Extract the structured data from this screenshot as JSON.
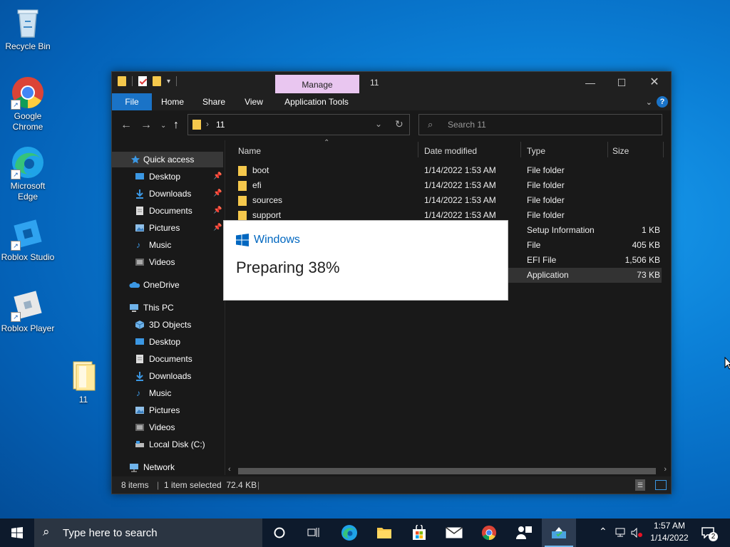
{
  "desktop": {
    "icons": [
      {
        "label": "Recycle Bin"
      },
      {
        "label": "Google Chrome"
      },
      {
        "label": "Microsoft Edge"
      },
      {
        "label": "Roblox Studio"
      },
      {
        "label": "Roblox Player"
      },
      {
        "label": "11"
      }
    ]
  },
  "window": {
    "title": "11",
    "manage_tab": "Manage",
    "ribbon_tabs": [
      "File",
      "Home",
      "Share",
      "View",
      "Application Tools"
    ],
    "address": {
      "path": "11"
    },
    "search": {
      "placeholder": "Search 11"
    },
    "nav": [
      {
        "label": "Quick access",
        "icon": "star-icon",
        "pinned": false
      },
      {
        "label": "Desktop",
        "icon": "desktop-icon",
        "pinned": true
      },
      {
        "label": "Downloads",
        "icon": "download-icon",
        "pinned": true
      },
      {
        "label": "Documents",
        "icon": "documents-icon",
        "pinned": true
      },
      {
        "label": "Pictures",
        "icon": "pictures-icon",
        "pinned": true
      },
      {
        "label": "Music",
        "icon": "music-icon",
        "pinned": false
      },
      {
        "label": "Videos",
        "icon": "videos-icon",
        "pinned": false
      },
      {
        "label": "OneDrive",
        "icon": "cloud-icon",
        "pinned": false
      },
      {
        "label": "This PC",
        "icon": "computer-icon",
        "pinned": false
      },
      {
        "label": "3D Objects",
        "icon": "cube-icon",
        "pinned": false
      },
      {
        "label": "Desktop",
        "icon": "desktop-icon",
        "pinned": false
      },
      {
        "label": "Documents",
        "icon": "documents-icon",
        "pinned": false
      },
      {
        "label": "Downloads",
        "icon": "download-icon",
        "pinned": false
      },
      {
        "label": "Music",
        "icon": "music-icon",
        "pinned": false
      },
      {
        "label": "Pictures",
        "icon": "pictures-icon",
        "pinned": false
      },
      {
        "label": "Videos",
        "icon": "videos-icon",
        "pinned": false
      },
      {
        "label": "Local Disk (C:)",
        "icon": "drive-icon",
        "pinned": false
      },
      {
        "label": "Network",
        "icon": "network-icon",
        "pinned": false
      }
    ],
    "columns": [
      "Name",
      "Date modified",
      "Type",
      "Size"
    ],
    "files": [
      {
        "name": "boot",
        "date": "1/14/2022 1:53 AM",
        "type": "File folder",
        "size": ""
      },
      {
        "name": "efi",
        "date": "1/14/2022 1:53 AM",
        "type": "File folder",
        "size": ""
      },
      {
        "name": "sources",
        "date": "1/14/2022 1:53 AM",
        "type": "File folder",
        "size": ""
      },
      {
        "name": "support",
        "date": "1/14/2022 1:53 AM",
        "type": "File folder",
        "size": ""
      },
      {
        "name": "",
        "date": "",
        "type": "Setup Information",
        "size": "1 KB"
      },
      {
        "name": "",
        "date": "",
        "type": "File",
        "size": "405 KB"
      },
      {
        "name": "",
        "date": "",
        "type": "EFI File",
        "size": "1,506 KB"
      },
      {
        "name": "",
        "date": "",
        "type": "Application",
        "size": "73 KB"
      }
    ],
    "status": {
      "items": "8 items",
      "selected": "1 item selected  72.4 KB"
    }
  },
  "popup": {
    "brand": "Windows",
    "status_text": "Preparing 38%",
    "progress_percent": 38
  },
  "taskbar": {
    "search_placeholder": "Type here to search",
    "time": "1:57 AM",
    "date": "1/14/2022",
    "notification_count": "2"
  },
  "colors": {
    "accent": "#1a73c7",
    "folder": "#f5c84c",
    "manage_tab": "#e9c6f0",
    "windows_blue": "#0067c0"
  }
}
